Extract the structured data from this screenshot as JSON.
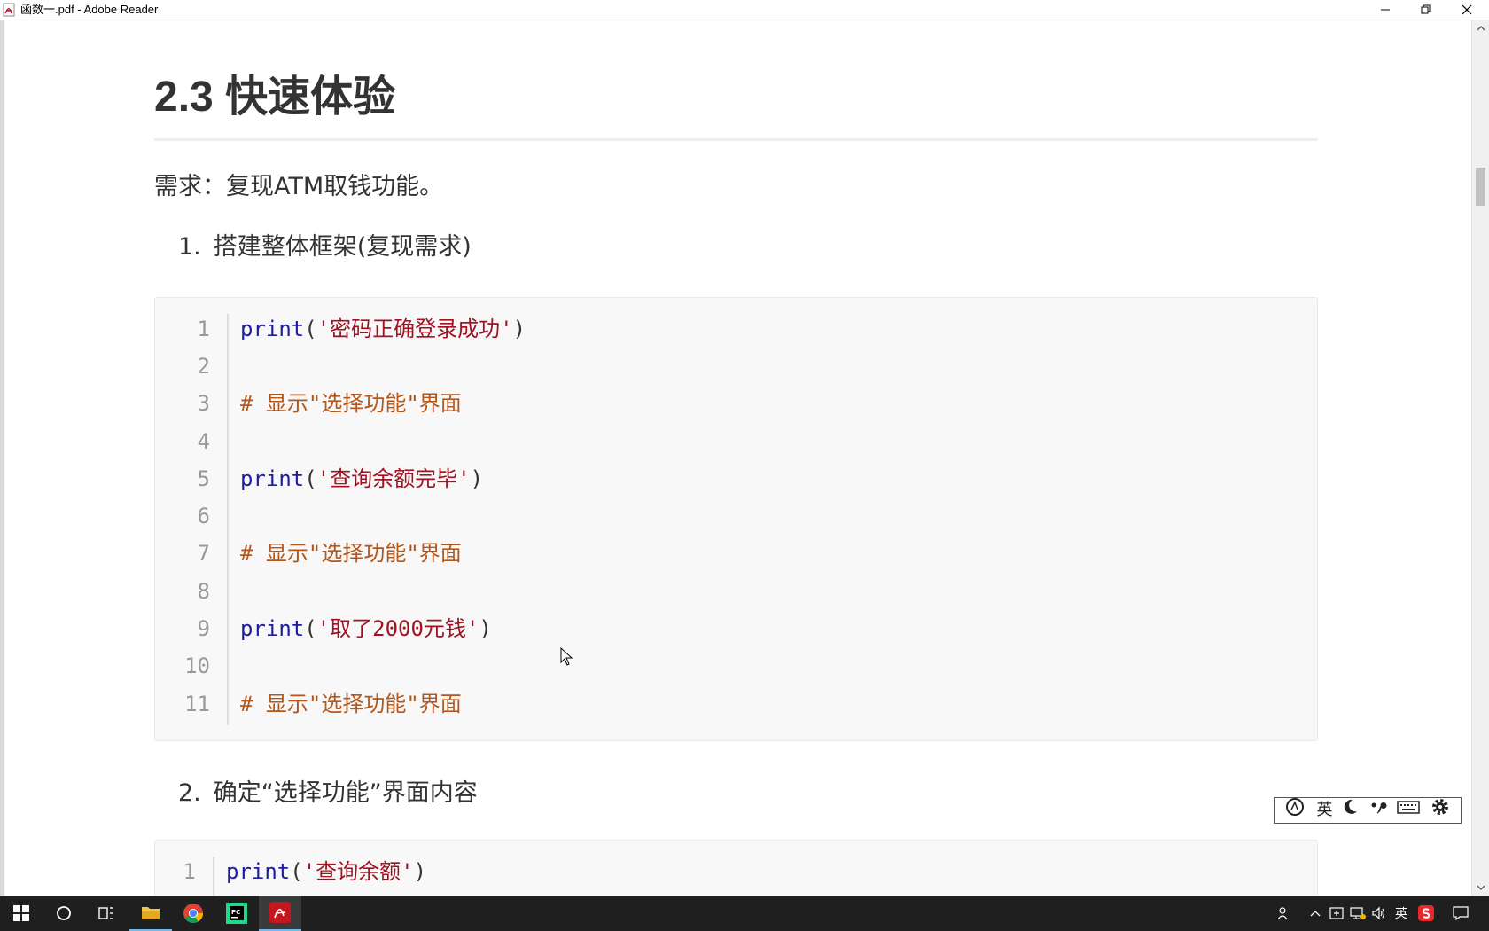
{
  "window": {
    "title": "函数一.pdf - Adobe Reader"
  },
  "document": {
    "heading": "2.3 快速体验",
    "requirement": "需求：复现ATM取钱功能。",
    "steps": [
      {
        "num": "1.",
        "text": "搭建整体框架(复现需求)"
      },
      {
        "num": "2.",
        "text": "确定“选择功能”界面内容"
      }
    ],
    "code_block_1": [
      {
        "line": "1",
        "keyword": "print",
        "open": "(",
        "string": "'密码正确登录成功'",
        "close": ")"
      },
      {
        "line": "2"
      },
      {
        "line": "3",
        "comment": "# 显示\"选择功能\"界面"
      },
      {
        "line": "4"
      },
      {
        "line": "5",
        "keyword": "print",
        "open": "(",
        "string": "'查询余额完毕'",
        "close": ")"
      },
      {
        "line": "6"
      },
      {
        "line": "7",
        "comment": "# 显示\"选择功能\"界面"
      },
      {
        "line": "8"
      },
      {
        "line": "9",
        "keyword": "print",
        "open": "(",
        "string": "'取了2000元钱'",
        "close": ")"
      },
      {
        "line": "10"
      },
      {
        "line": "11",
        "comment": "# 显示\"选择功能\"界面"
      }
    ],
    "code_block_2": [
      {
        "line": "1",
        "keyword": "print",
        "open": "(",
        "string": "'查询余额'",
        "close": ")"
      }
    ]
  },
  "ime_toolbar": {
    "language": "英",
    "icons": [
      "sogou-logo-icon",
      "moon-icon",
      "punctuation-icon",
      "keyboard-icon",
      "gear-icon"
    ]
  },
  "taskbar": {
    "apps": [
      "windows-start-icon",
      "search-icon",
      "task-view-icon",
      "file-explorer-icon",
      "chrome-icon",
      "pycharm-icon",
      "adobe-reader-icon"
    ],
    "tray": {
      "ime_language": "英"
    }
  },
  "colors": {
    "keyword": "#1d1d9e",
    "string": "#a11122",
    "comment": "#b5561a",
    "line_number": "#999999",
    "code_background": "#f8f8f8",
    "taskbar": "#1f1f1f"
  }
}
